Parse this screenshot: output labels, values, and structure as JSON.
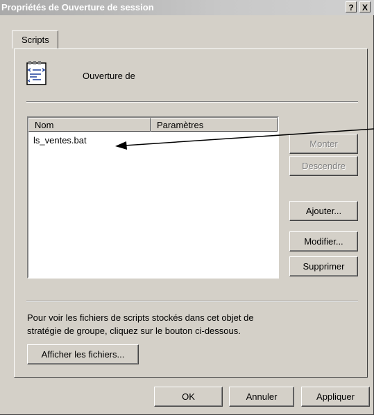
{
  "window": {
    "title": "Propriétés de Ouverture de session",
    "help_button": "?",
    "close_button": "X"
  },
  "tabs": [
    {
      "label": "Scripts",
      "active": true
    }
  ],
  "header": {
    "icon": "script-file-icon",
    "title": "Ouverture de"
  },
  "scripts_list": {
    "columns": [
      "Nom",
      "Paramètres"
    ],
    "rows": [
      {
        "name": "ls_ventes.bat",
        "parameters": ""
      }
    ]
  },
  "side_buttons": {
    "up": "Monter",
    "down": "Descendre",
    "add": "Ajouter...",
    "edit": "Modifier...",
    "remove": "Supprimer"
  },
  "info": {
    "line1": "Pour voir les fichiers de scripts stockés dans cet objet de",
    "line2": "stratégie de groupe, cliquez sur le bouton ci-dessous.",
    "show_files": "Afficher les fichiers..."
  },
  "footer": {
    "ok": "OK",
    "cancel": "Annuler",
    "apply": "Appliquer"
  },
  "colors": {
    "dialog_face": "#d4d0c8",
    "title_gradient_start": "#a9a9a9",
    "disabled_text": "#808080"
  }
}
